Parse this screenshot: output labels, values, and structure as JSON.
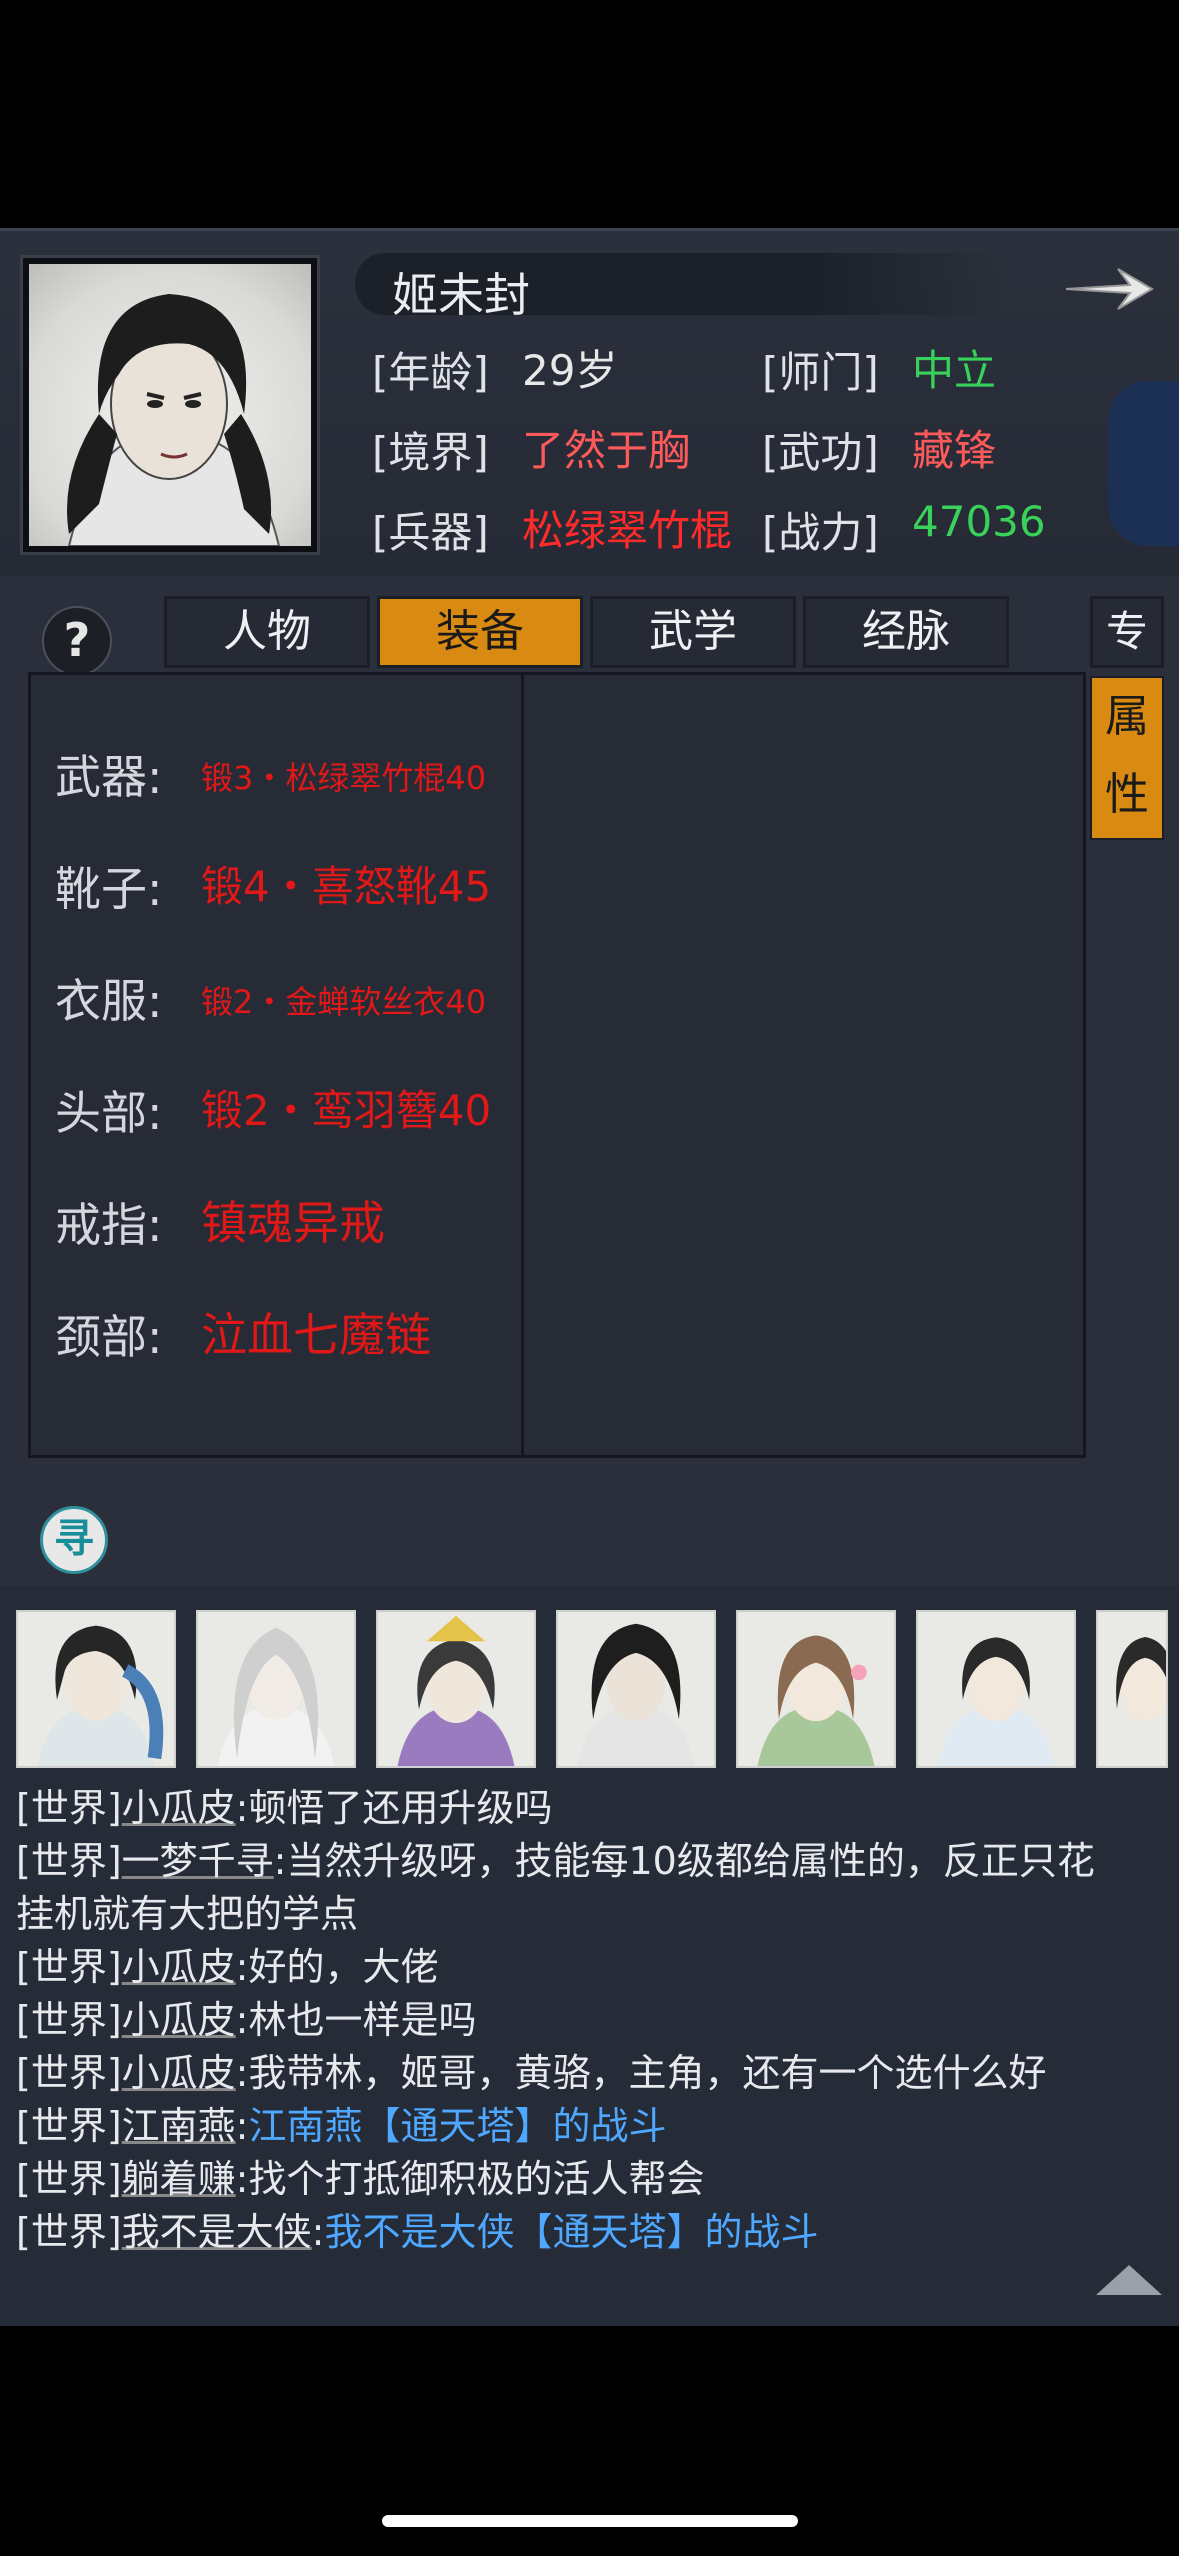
{
  "character": {
    "name": "姬未封",
    "attributes": [
      {
        "key": "[年龄]",
        "value": "29岁",
        "color": "#e8e8e8"
      },
      {
        "key": "[师门]",
        "value": "中立",
        "color": "#38d25a"
      },
      {
        "key": "[境界]",
        "value": "了然于胸",
        "color": "#ff5a5a"
      },
      {
        "key": "[武功]",
        "value": "藏锋",
        "color": "#ff5a5a"
      },
      {
        "key": "[兵器]",
        "value": "松绿翠竹棍",
        "color": "#ff2a2a"
      },
      {
        "key": "[战力]",
        "value": "47036",
        "color": "#38d25a"
      }
    ]
  },
  "help_icon": "?",
  "tabs": [
    {
      "label": "人物",
      "active": false
    },
    {
      "label": "装备",
      "active": true
    },
    {
      "label": "武学",
      "active": false
    },
    {
      "label": "经脉",
      "active": false
    }
  ],
  "side_tabs": {
    "top": "专",
    "attr_1": "属",
    "attr_2": "性"
  },
  "equipment": [
    {
      "slot": "武器:",
      "item": "锻3・松绿翠竹棍40"
    },
    {
      "slot": "靴子:",
      "item": "锻4・喜怒靴45"
    },
    {
      "slot": "衣服:",
      "item": "锻2・金蝉软丝衣40"
    },
    {
      "slot": "头部:",
      "item": "锻2・鸾羽簪40"
    },
    {
      "slot": "戒指:",
      "item": "镇魂异戒"
    },
    {
      "slot": "颈部:",
      "item": "泣血七魔链"
    }
  ],
  "search_icon": "寻",
  "chat": {
    "lines": [
      {
        "channel": "[世界]",
        "user": "小瓜皮",
        "text": ":顿悟了还用升级吗",
        "link": ""
      },
      {
        "channel": "[世界]",
        "user": "一梦千寻",
        "text": ":当然升级呀，技能每10级都给属性的，反正只花",
        "link": ""
      },
      {
        "channel": "",
        "user": "",
        "text": "挂机就有大把的学点",
        "link": ""
      },
      {
        "channel": "[世界]",
        "user": "小瓜皮",
        "text": ":好的，大佬",
        "link": ""
      },
      {
        "channel": "[世界]",
        "user": "小瓜皮",
        "text": ":林也一样是吗",
        "link": ""
      },
      {
        "channel": "[世界]",
        "user": "小瓜皮",
        "text": ":我带林，姬哥，黄骆，主角，还有一个选什么好",
        "link": ""
      },
      {
        "channel": "[世界]",
        "user": "江南燕",
        "text": ":",
        "link": "江南燕【通天塔】的战斗"
      },
      {
        "channel": "[世界]",
        "user": "躺着赚",
        "text": ":找个打抵御积极的活人帮会",
        "link": ""
      },
      {
        "channel": "[世界]",
        "user": "我不是大侠",
        "text": ":",
        "link": "我不是大侠【通天塔】的战斗"
      }
    ]
  }
}
